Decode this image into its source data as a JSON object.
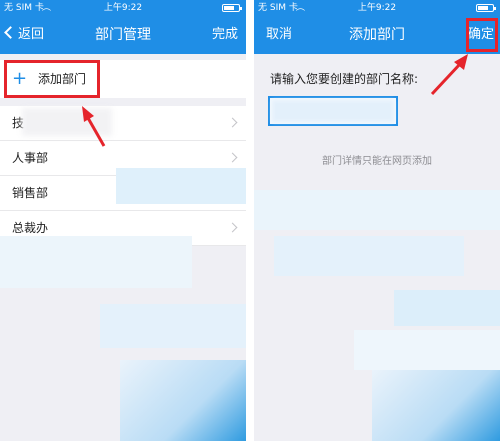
{
  "status_bar": {
    "carrier": "无 SIM 卡",
    "time": "上午9:22"
  },
  "left_screen": {
    "nav": {
      "back_label": "返回",
      "title": "部门管理",
      "done_label": "完成"
    },
    "add_row": {
      "icon": "plus-icon",
      "label": "添加部门"
    },
    "departments": [
      {
        "label": "技"
      },
      {
        "label": "人事部"
      },
      {
        "label": "销售部"
      },
      {
        "label": "总裁办"
      }
    ]
  },
  "right_screen": {
    "nav": {
      "cancel_label": "取消",
      "title": "添加部门",
      "confirm_label": "确定"
    },
    "form": {
      "prompt": "请输入您要创建的部门名称:",
      "value": ""
    },
    "hint": "部门详情只能在网页添加"
  },
  "colors": {
    "nav_blue": "#1f8ee6",
    "annotation_red": "#e5242b"
  }
}
